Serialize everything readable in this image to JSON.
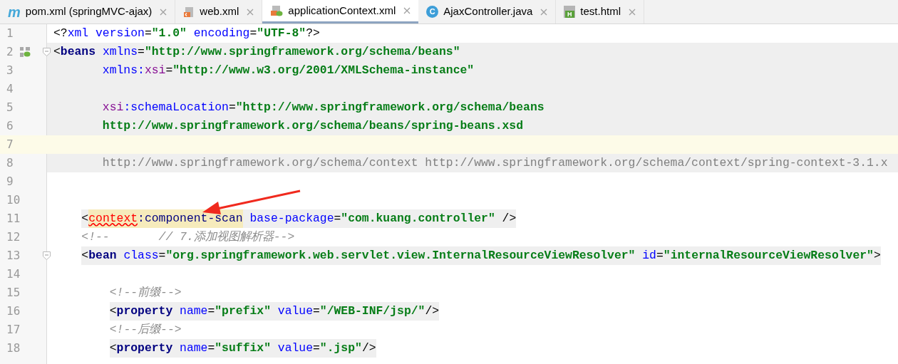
{
  "tabs": [
    {
      "label": "pom.xml (springMVC-ajax)",
      "kind": "maven",
      "icon_text": "m",
      "selected": false
    },
    {
      "label": "web.xml",
      "kind": "xml",
      "selected": false
    },
    {
      "label": "applicationContext.xml",
      "kind": "spring-xml",
      "selected": true
    },
    {
      "label": "AjaxController.java",
      "kind": "java-class",
      "icon_text": "C",
      "selected": false
    },
    {
      "label": "test.html",
      "kind": "html",
      "icon_text": "H",
      "selected": false
    }
  ],
  "editor": {
    "lines": [
      {
        "number": "1",
        "kind": "plain",
        "fold": false,
        "bean_icon": false,
        "tokens": [
          {
            "kind": "p",
            "text": "<?"
          },
          {
            "kind": "attr",
            "text": "xml version"
          },
          {
            "kind": "p",
            "text": "="
          },
          {
            "kind": "val",
            "text": "\"1.0\" "
          },
          {
            "kind": "attr",
            "text": "encoding"
          },
          {
            "kind": "p",
            "text": "="
          },
          {
            "kind": "val",
            "text": "\"UTF-8\""
          },
          {
            "kind": "p",
            "text": "?>"
          }
        ]
      },
      {
        "number": "2",
        "kind": "block",
        "fold": true,
        "bean_icon": true,
        "tokens": [
          {
            "kind": "p",
            "text": "<"
          },
          {
            "kind": "tag",
            "text": "beans "
          },
          {
            "kind": "attr",
            "text": "xmlns"
          },
          {
            "kind": "p",
            "text": "="
          },
          {
            "kind": "val",
            "text": "\"http://www.springframework.org/schema/beans\""
          }
        ]
      },
      {
        "number": "3",
        "kind": "block",
        "fold": false,
        "bean_icon": false,
        "tokens": [
          {
            "kind": "attr",
            "text": "       xmlns:"
          },
          {
            "kind": "ns",
            "text": "xsi"
          },
          {
            "kind": "p",
            "text": "="
          },
          {
            "kind": "val",
            "text": "\"http://www.w3.org/2001/XMLSchema-instance\""
          }
        ]
      },
      {
        "number": "4",
        "kind": "block",
        "fold": false,
        "bean_icon": false
      },
      {
        "number": "5",
        "kind": "block",
        "fold": false,
        "bean_icon": false,
        "tokens": [
          {
            "kind": "ns",
            "text": "       xsi"
          },
          {
            "kind": "attr",
            "text": ":schemaLocation"
          },
          {
            "kind": "p",
            "text": "="
          },
          {
            "kind": "val",
            "text": "\"http://www.springframework.org/schema/beans"
          }
        ]
      },
      {
        "number": "6",
        "kind": "block",
        "fold": false,
        "bean_icon": false,
        "tokens": [
          {
            "kind": "val",
            "text": "       http://www.springframework.org/schema/beans/spring-beans.xsd"
          }
        ]
      },
      {
        "number": "7",
        "kind": "caret",
        "fold": false,
        "bean_icon": false
      },
      {
        "number": "8",
        "kind": "block",
        "fold": false,
        "bean_icon": false,
        "tokens": [
          {
            "kind": "dim",
            "text": "       http://www.springframework.org/schema/context http://www.springframework.org/schema/context/spring-context-3.1.x"
          }
        ]
      },
      {
        "number": "9",
        "kind": "plain",
        "fold": false,
        "bean_icon": false
      },
      {
        "number": "10",
        "kind": "plain",
        "fold": false,
        "bean_icon": false
      },
      {
        "number": "11",
        "kind": "tag",
        "fold": false,
        "bean_icon": false,
        "tokens": [
          {
            "kind": "p",
            "text": "    <"
          },
          {
            "kind": "err",
            "text": "context"
          },
          {
            "kind": "tagmatch",
            "text": ":component-scan"
          },
          {
            "kind": "attr",
            "text": " base-package"
          },
          {
            "kind": "p",
            "text": "="
          },
          {
            "kind": "val",
            "text": "\"com.kuang.controller\""
          },
          {
            "kind": "p",
            "text": " />"
          }
        ]
      },
      {
        "number": "12",
        "kind": "plain",
        "fold": false,
        "bean_icon": false,
        "tokens": [
          {
            "kind": "com",
            "text": "    <!--       // 7.添加视图解析器-->"
          }
        ]
      },
      {
        "number": "13",
        "kind": "tag",
        "fold": true,
        "bean_icon": false,
        "tokens": [
          {
            "kind": "p",
            "text": "    <"
          },
          {
            "kind": "tag",
            "text": "bean "
          },
          {
            "kind": "attr",
            "text": "class"
          },
          {
            "kind": "p",
            "text": "="
          },
          {
            "kind": "val",
            "text": "\"org.springframework.web.servlet.view.InternalResourceViewResolver\" "
          },
          {
            "kind": "attr",
            "text": "id"
          },
          {
            "kind": "p",
            "text": "="
          },
          {
            "kind": "val",
            "text": "\"internalResourceViewResolver\""
          },
          {
            "kind": "p",
            "text": ">"
          }
        ]
      },
      {
        "number": "14",
        "kind": "plain",
        "fold": false,
        "bean_icon": false
      },
      {
        "number": "15",
        "kind": "plain",
        "fold": false,
        "bean_icon": false,
        "tokens": [
          {
            "kind": "com",
            "text": "        <!--前缀-->"
          }
        ]
      },
      {
        "number": "16",
        "kind": "tag",
        "fold": false,
        "bean_icon": false,
        "tokens": [
          {
            "kind": "p",
            "text": "        <"
          },
          {
            "kind": "tag",
            "text": "property "
          },
          {
            "kind": "attr",
            "text": "name"
          },
          {
            "kind": "p",
            "text": "="
          },
          {
            "kind": "val",
            "text": "\"prefix\" "
          },
          {
            "kind": "attr",
            "text": "value"
          },
          {
            "kind": "p",
            "text": "="
          },
          {
            "kind": "val",
            "text": "\"/WEB-INF/jsp/\""
          },
          {
            "kind": "p",
            "text": "/>"
          }
        ]
      },
      {
        "number": "17",
        "kind": "plain",
        "fold": false,
        "bean_icon": false,
        "tokens": [
          {
            "kind": "com",
            "text": "        <!--后缀-->"
          }
        ]
      },
      {
        "number": "18",
        "kind": "tag",
        "fold": false,
        "bean_icon": false,
        "tokens": [
          {
            "kind": "p",
            "text": "        <"
          },
          {
            "kind": "tag",
            "text": "property "
          },
          {
            "kind": "attr",
            "text": "name"
          },
          {
            "kind": "p",
            "text": "="
          },
          {
            "kind": "val",
            "text": "\"suffix\" "
          },
          {
            "kind": "attr",
            "text": "value"
          },
          {
            "kind": "p",
            "text": "="
          },
          {
            "kind": "val",
            "text": "\".jsp\""
          },
          {
            "kind": "p",
            "text": "/>"
          }
        ]
      }
    ]
  }
}
